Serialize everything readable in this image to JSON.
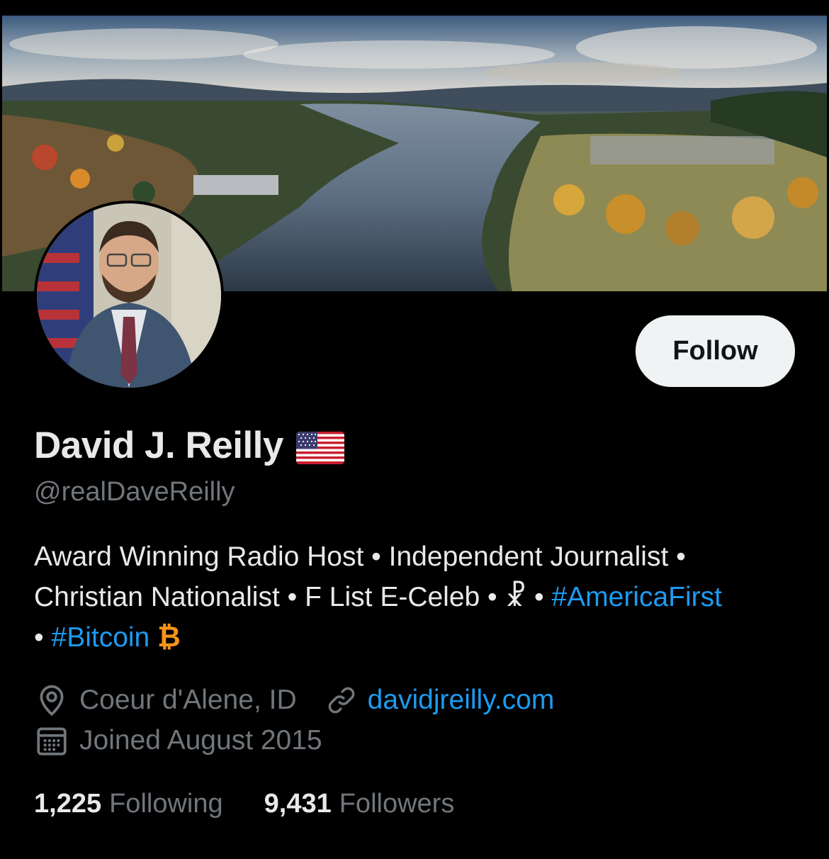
{
  "profile": {
    "display_name": "David J. Reilly",
    "name_emoji": "flag-us-icon",
    "handle": "@realDaveReilly",
    "follow_label": "Follow"
  },
  "bio": {
    "line1": "Award Winning Radio Host • Independent Journalist •",
    "line2_prefix": "Christian Nationalist • F List E-Celeb • ☧ • ",
    "hashtag1": "#AmericaFirst",
    "line3_prefix": "• ",
    "hashtag2": "#Bitcoin",
    "bitcoin_symbol": "₿"
  },
  "meta": {
    "location_icon": "location-pin-icon",
    "location": "Coeur d'Alene, ID",
    "link_icon": "link-icon",
    "website": "davidjreilly.com",
    "calendar_icon": "calendar-icon",
    "joined": "Joined August 2015"
  },
  "stats": {
    "following_count": "1,225",
    "following_label": "Following",
    "followers_count": "9,431",
    "followers_label": "Followers"
  },
  "colors": {
    "background": "#000000",
    "text_primary": "#e7e9ea",
    "text_secondary": "#71767b",
    "link": "#1d9bf0",
    "button_bg": "#eff3f4",
    "button_text": "#0f1419",
    "bitcoin": "#f7931a"
  }
}
